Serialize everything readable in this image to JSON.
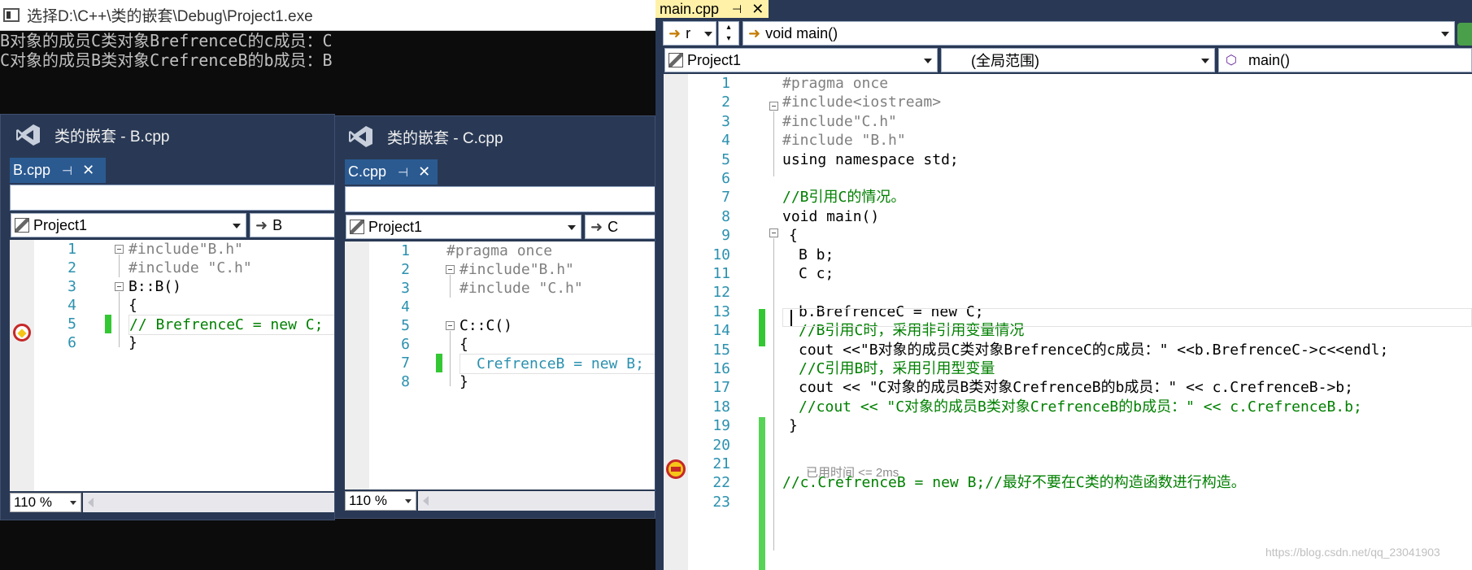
{
  "console": {
    "title": "选择D:\\C++\\类的嵌套\\Debug\\Project1.exe",
    "lines": [
      "B对象的成员C类对象BrefrenceC的c成员：C",
      "C对象的成员B类对象CrefrenceB的b成员：B"
    ]
  },
  "window_b": {
    "title": "类的嵌套 - B.cpp",
    "tab": "B.cpp",
    "project_combo": "Project1",
    "scope_combo": "B",
    "zoom": "110 %",
    "lines": [
      {
        "no": "1",
        "text": "#include\"B.h\""
      },
      {
        "no": "2",
        "text": "#include \"C.h\""
      },
      {
        "no": "3",
        "text": "B::B()"
      },
      {
        "no": "4",
        "text": "{"
      },
      {
        "no": "5",
        "text": "// BrefrenceC = new C;"
      },
      {
        "no": "6",
        "text": "}"
      }
    ]
  },
  "window_c": {
    "title": "类的嵌套 - C.cpp",
    "tab": "C.cpp",
    "project_combo": "Project1",
    "scope_combo": "C",
    "zoom": "110 %",
    "lines": [
      {
        "no": "1",
        "text": "#pragma once"
      },
      {
        "no": "2",
        "text": "#include\"B.h\""
      },
      {
        "no": "3",
        "text": "#include \"C.h\""
      },
      {
        "no": "4",
        "text": ""
      },
      {
        "no": "5",
        "text": "C::C()"
      },
      {
        "no": "6",
        "text": "{"
      },
      {
        "no": "7",
        "text": "CrefrenceB = new B;"
      },
      {
        "no": "8",
        "text": "}"
      }
    ]
  },
  "main_window": {
    "tab": "main.cpp",
    "toolbar_left_combo": "r",
    "toolbar_func_combo": "void main()",
    "project_combo": "Project1",
    "scope_combo": "(全局范围)",
    "member_combo": "main()",
    "elapsed_hint": "已用时间 <= 2ms",
    "watermark": "https://blog.csdn.net/qq_23041903",
    "line_numbers": [
      "1",
      "2",
      "3",
      "4",
      "5",
      "6",
      "7",
      "8",
      "9",
      "10",
      "11",
      "12",
      "13",
      "14",
      "15",
      "16",
      "17",
      "18",
      "19",
      "20",
      "21",
      "22",
      "23"
    ],
    "lines": [
      "#pragma once",
      "#include<iostream>",
      "#include\"C.h\"",
      "#include \"B.h\"",
      "using namespace std;",
      "",
      "//B引用C的情况。",
      "void main()",
      "{",
      "B b;",
      "C c;",
      "",
      "b.BrefrenceC = new C;",
      "//B引用C时，采用非引用变量情况",
      "cout <<\"B对象的成员C类对象BrefrenceC的c成员：\" <<b.BrefrenceC->c<<endl;",
      "//C引用B时，采用引用型变量",
      "cout << \"C对象的成员B类对象CrefrenceB的b成员：\" << c.CrefrenceB->b;",
      "//cout << \"C对象的成员B类对象CrefrenceB的b成员：\" << c.CrefrenceB.b;",
      "}",
      "",
      "",
      "//c.CrefrenceB = new B;//最好不要在C类的构造函数进行构造。",
      ""
    ]
  },
  "colors": {
    "vs_frame": "#293955",
    "active_tab": "#fff1a8",
    "inactive_tab": "#2b5a91",
    "change_indicator": "#34c734"
  }
}
